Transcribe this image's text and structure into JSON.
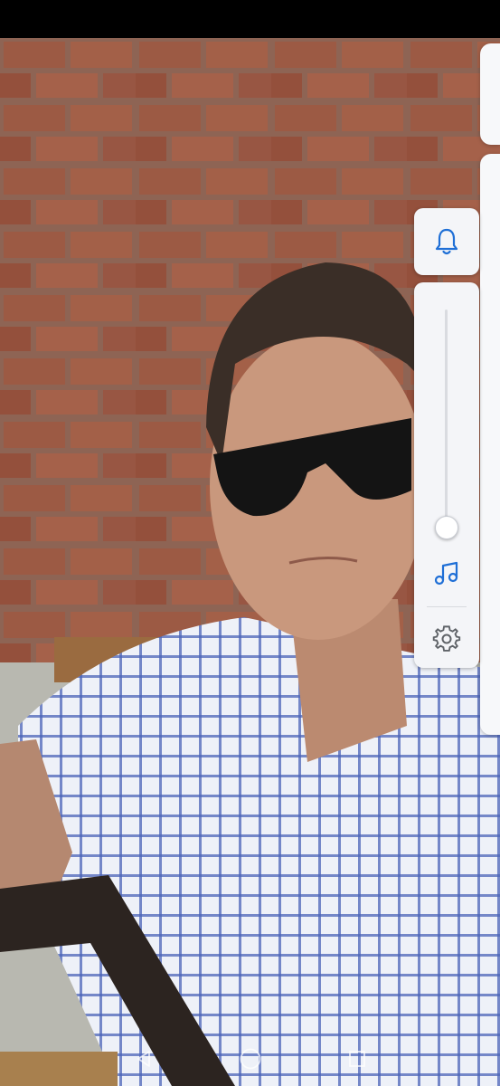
{
  "volume_panel": {
    "ringer_icon": "bell-icon",
    "media_icon": "music-note-icon",
    "settings_icon": "gear-icon",
    "level": 0.0,
    "accent_color": "#1f6fd6"
  },
  "navigation": {
    "back_icon": "back-triangle-icon",
    "home_icon": "home-circle-icon",
    "recents_icon": "recents-square-icon"
  }
}
